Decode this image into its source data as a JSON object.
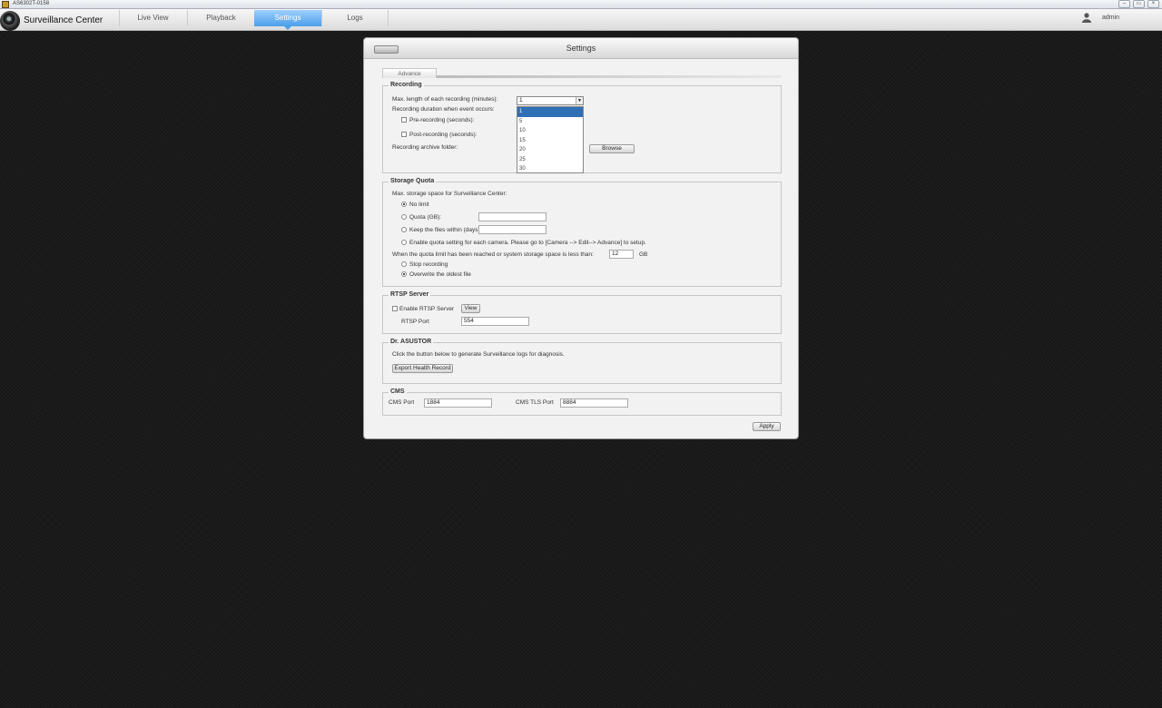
{
  "window": {
    "title": "AS6302T-0158",
    "buttons": [
      "–",
      "▭",
      "×"
    ]
  },
  "app": {
    "name": "Surveillance Center"
  },
  "nav": {
    "tabs": [
      "Live View",
      "Playback",
      "Settings",
      "Logs"
    ],
    "active": "Settings"
  },
  "user": {
    "name": "admin"
  },
  "dialog": {
    "title": "Settings",
    "subtab": "Advance",
    "recording": {
      "legend": "Recording",
      "max_length_label": "Max. length of each recording (minutes):",
      "max_length_value": "1",
      "options": [
        "1",
        "5",
        "10",
        "15",
        "20",
        "25",
        "30"
      ],
      "duration_label": "Recording duration when event occurs:",
      "pre_label": "Pre-recording (seconds):",
      "post_label": "Post-recording (seconds):",
      "archive_label": "Recording archive folder:",
      "browse": "Browse"
    },
    "quota": {
      "legend": "Storage Quota",
      "max_label": "Max. storage space for Surveillance Center:",
      "no_limit": "No limit",
      "quota_gb": "Quota (GB):",
      "keep_days": "Keep the files within (days)",
      "per_camera": "Enable quota setting for each camera. Please go to [Camera --> Edit--> Advance] to setup.",
      "limit_label": "When the quota limit has been reached or system storage space is less than:",
      "limit_value": "12",
      "limit_unit": "GB",
      "stop": "Stop recording",
      "overwrite": "Overwrite the oldest file"
    },
    "rtsp": {
      "legend": "RTSP Server",
      "enable_label": "Enable RTSP Server",
      "view": "View",
      "port_label": "RTSP Port",
      "port_value": "554"
    },
    "dr": {
      "legend": "Dr. ASUSTOR",
      "desc": "Click the button below to generate Surveillance logs for diagnosis.",
      "export": "Export Health Record"
    },
    "cms": {
      "legend": "CMS",
      "port_label": "CMS Port",
      "port_value": "1884",
      "tls_label": "CMS TLS Port",
      "tls_value": "8884"
    },
    "apply": "Apply"
  }
}
